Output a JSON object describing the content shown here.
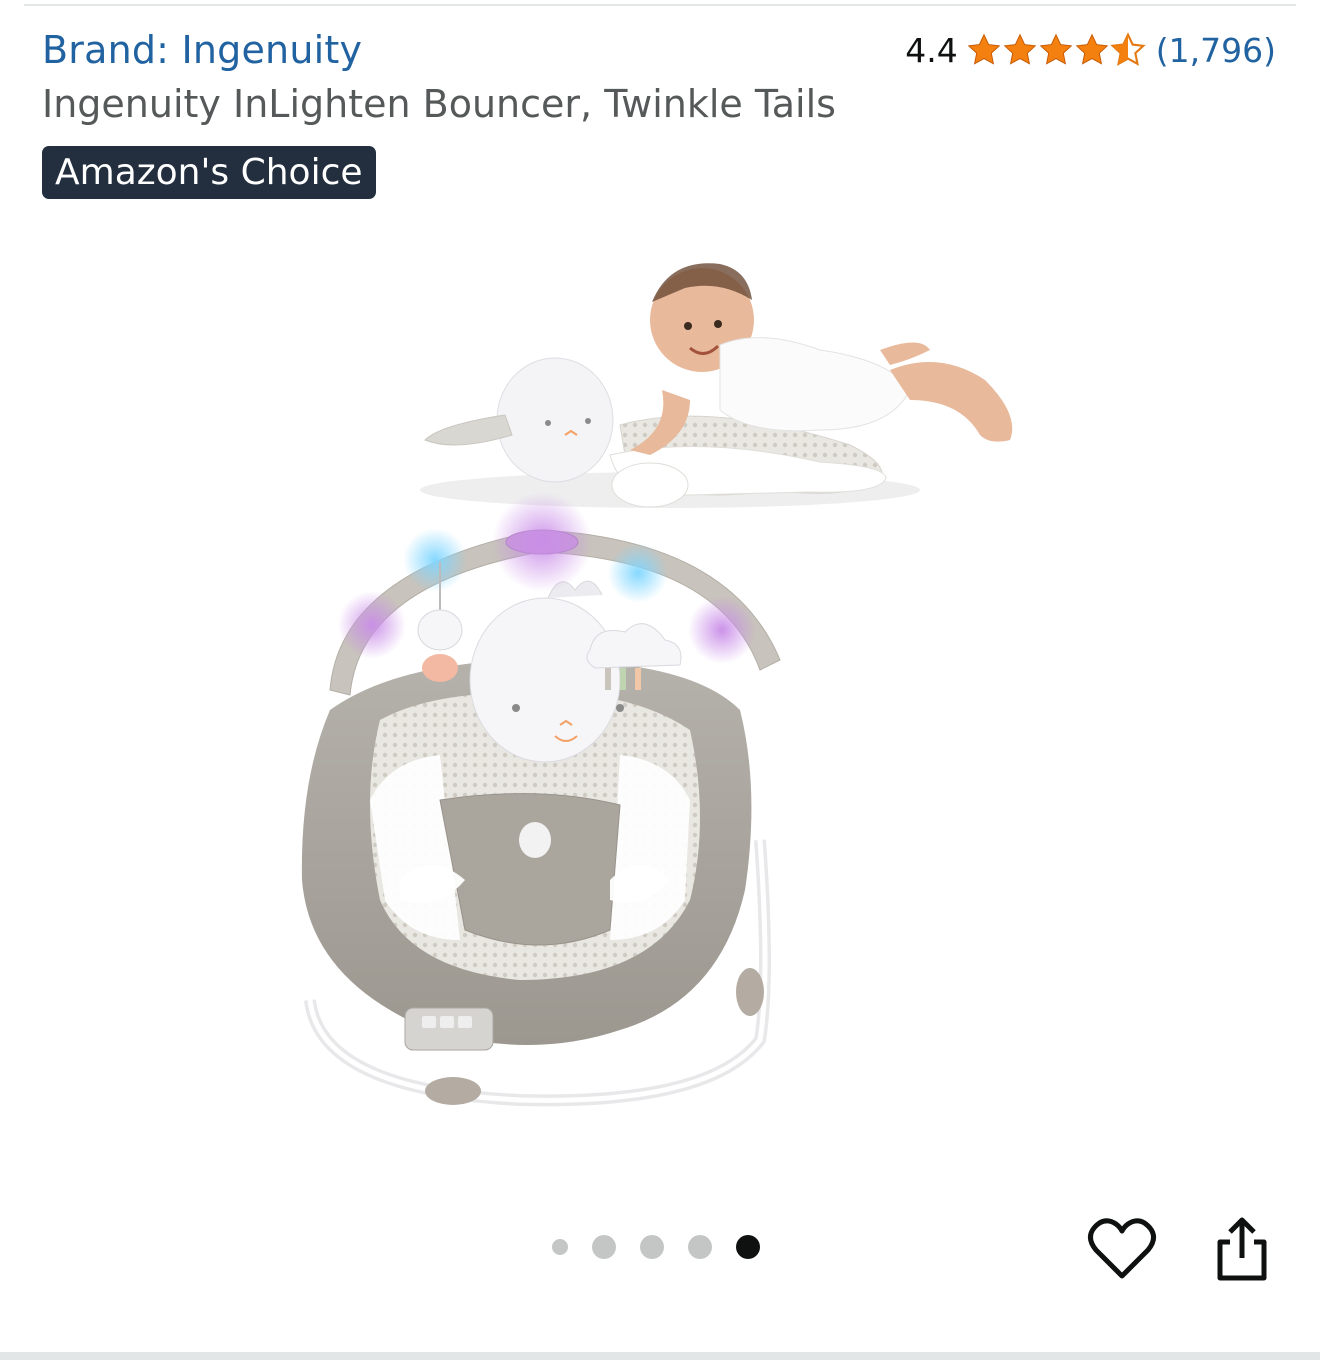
{
  "header": {
    "brand_label": "Brand: Ingenuity",
    "product_title": "Ingenuity InLighten Bouncer, Twinkle Tails",
    "badge_label": "Amazon's Choice"
  },
  "rating": {
    "value_label": "4.4",
    "value": 4.4,
    "max": 5,
    "count_label": "(1,796)"
  },
  "gallery": {
    "image_count": 5,
    "active_index": 4,
    "image_description_icon": "baby-bouncer-product-photo"
  },
  "actions": {
    "favorite_icon": "heart-icon",
    "share_icon": "share-icon"
  },
  "colors": {
    "link_blue": "#2162a1",
    "star_orange": "#f3800f",
    "badge_bg": "#232f3e",
    "title_gray": "#565959"
  }
}
